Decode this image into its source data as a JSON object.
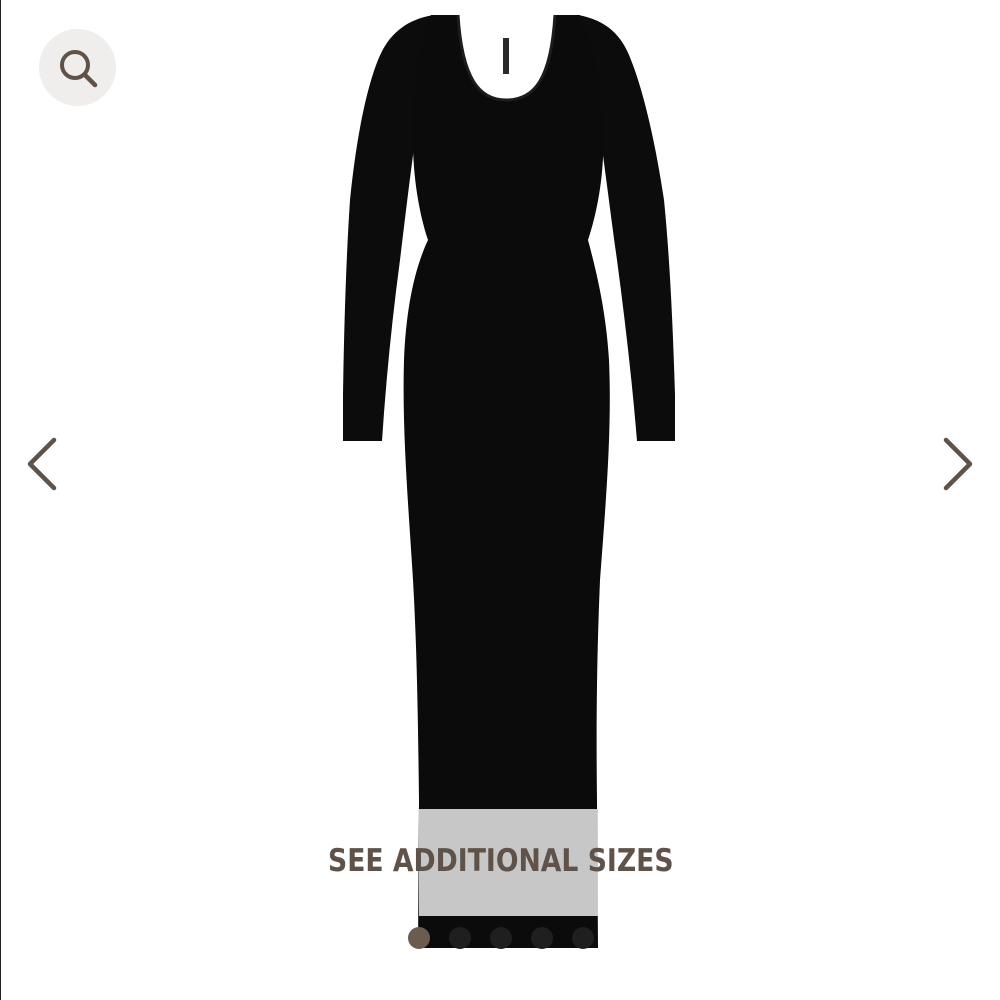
{
  "gallery": {
    "banner_label": "SEE ADDITIONAL SIZES",
    "dots": [
      {
        "active": true
      },
      {
        "active": false
      },
      {
        "active": false
      },
      {
        "active": false
      },
      {
        "active": false
      }
    ]
  },
  "colors": {
    "accent": "#5f5248",
    "search_bg": "#efeeec",
    "product": "#0b0b0b",
    "banner_bg": "#d2d2d2"
  },
  "icons": {
    "search": "search-icon",
    "prev": "chevron-left-icon",
    "next": "chevron-right-icon"
  }
}
